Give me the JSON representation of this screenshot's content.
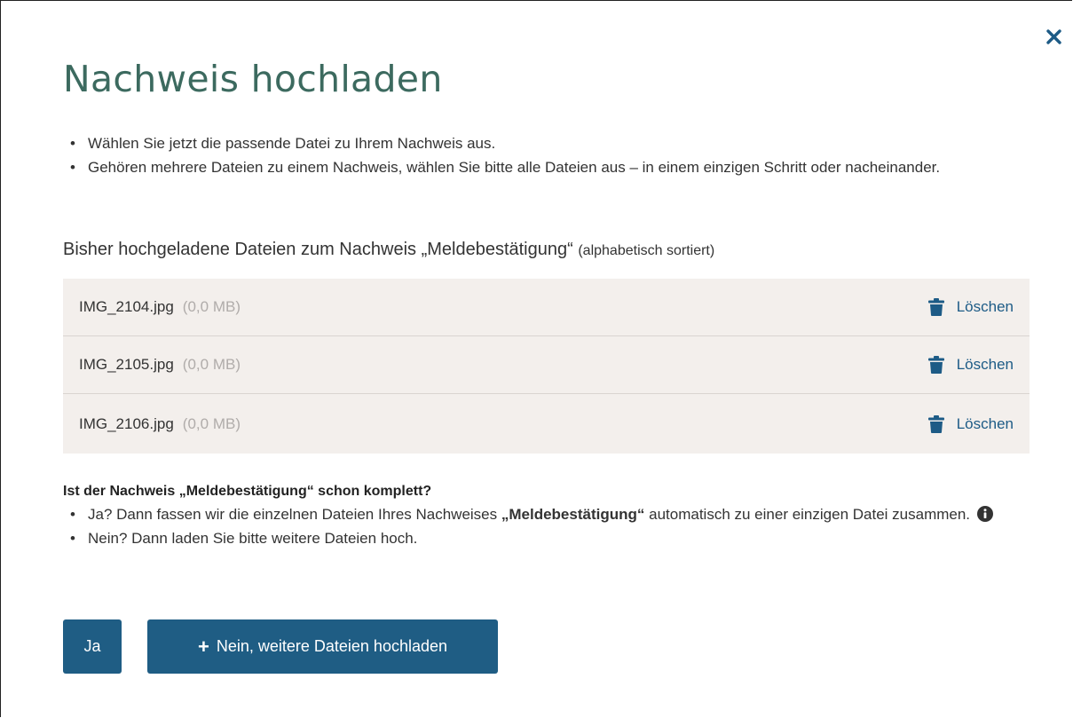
{
  "dialog": {
    "title": "Nachweis hochladen",
    "close_icon": "close-icon"
  },
  "intro": {
    "bullets": [
      "Wählen Sie jetzt die passende Datei zu Ihrem Nachweis aus.",
      "Gehören mehrere Dateien zu einem Nachweis, wählen Sie bitte alle Dateien aus – in einem einzigen Schritt oder nacheinander."
    ]
  },
  "uploaded": {
    "heading": "Bisher hochgeladene Dateien zum Nachweis „Meldebestätigung“",
    "sort_hint": "(alphabetisch sortiert)",
    "files": [
      {
        "name": "IMG_2104.jpg",
        "size": "(0,0 MB)",
        "delete_label": "Löschen"
      },
      {
        "name": "IMG_2105.jpg",
        "size": "(0,0 MB)",
        "delete_label": "Löschen"
      },
      {
        "name": "IMG_2106.jpg",
        "size": "(0,0 MB)",
        "delete_label": "Löschen"
      }
    ]
  },
  "complete": {
    "question": "Ist der Nachweis „Meldebestätigung“ schon komplett?",
    "yes_text_before": "Ja? Dann fassen wir die einzelnen Dateien Ihres Nachweises ",
    "yes_text_bold": "„Meldebestätigung“",
    "yes_text_after": " automatisch zu einer einzigen Datei zusammen.",
    "no_text": "Nein? Dann laden Sie bitte weitere Dateien hoch."
  },
  "buttons": {
    "yes_label": "Ja",
    "no_plus": "+",
    "no_label": "Nein, weitere Dateien hochladen"
  },
  "colors": {
    "title": "#3c6a5f",
    "primary": "#1f5d84",
    "link": "#1d5b86",
    "file_list_bg": "#f3efec",
    "muted": "#b0acaa"
  }
}
